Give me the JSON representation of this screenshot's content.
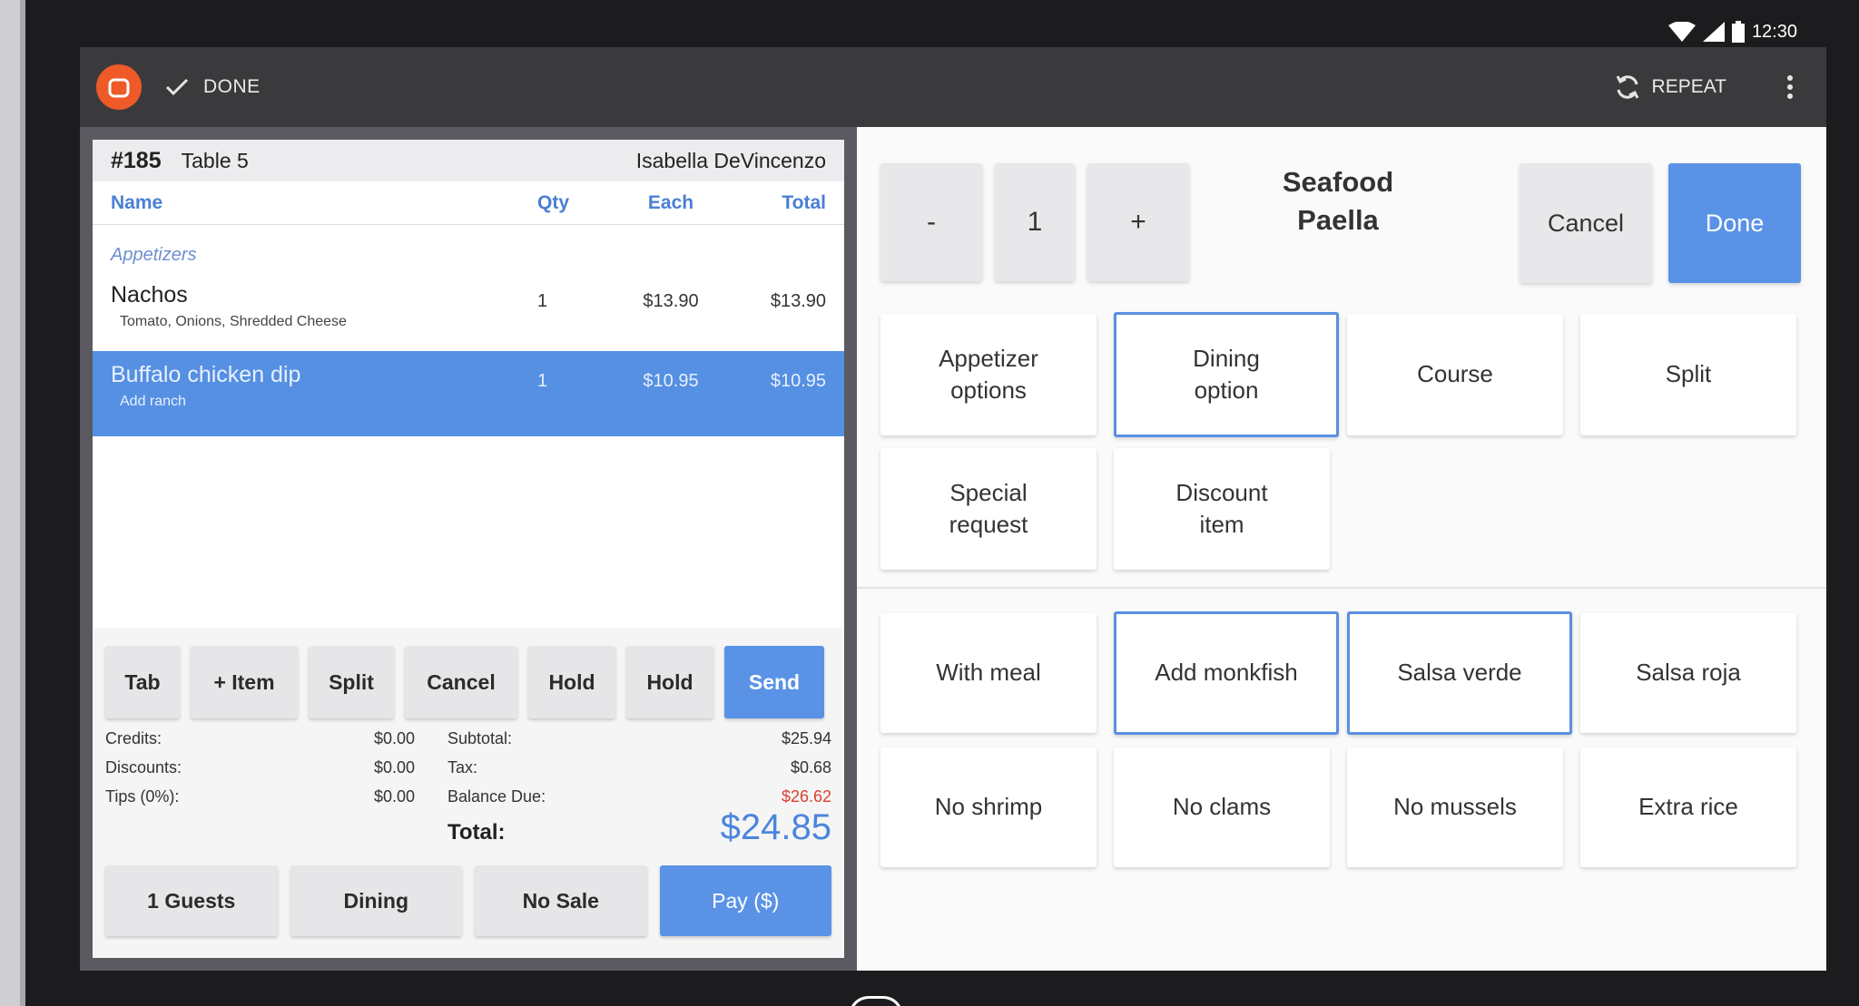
{
  "status": {
    "time": "12:30"
  },
  "appbar": {
    "done_label": "DONE",
    "repeat_label": "REPEAT"
  },
  "ticket": {
    "number": "#185",
    "table": "Table 5",
    "server": "Isabella DeVincenzo",
    "columns": {
      "name": "Name",
      "qty": "Qty",
      "each": "Each",
      "total": "Total"
    },
    "category": "Appetizers",
    "items": [
      {
        "name": "Nachos",
        "modifiers": "Tomato, Onions, Shredded Cheese",
        "qty": "1",
        "each": "$13.90",
        "total": "$13.90"
      },
      {
        "name": "Buffalo chicken dip",
        "modifiers": "Add ranch",
        "qty": "1",
        "each": "$10.95",
        "total": "$10.95"
      }
    ]
  },
  "actions": [
    "Tab",
    "+ Item",
    "Split",
    "Cancel",
    "Hold",
    "Hold",
    "Send"
  ],
  "totals": {
    "credits_label": "Credits:",
    "credits": "$0.00",
    "discounts_label": "Discounts:",
    "discounts": "$0.00",
    "tips_label": "Tips (0%):",
    "tips": "$0.00",
    "subtotal_label": "Subtotal:",
    "subtotal": "$25.94",
    "tax_label": "Tax:",
    "tax": "$0.68",
    "balance_label": "Balance Due:",
    "balance": "$26.62",
    "total_label": "Total:",
    "total": "$24.85"
  },
  "bottom": {
    "guests": "1 Guests",
    "dining": "Dining",
    "no_sale": "No Sale",
    "pay": "Pay ($)"
  },
  "editor": {
    "minus": "-",
    "quantity": "1",
    "plus": "+",
    "item_line1": "Seafood",
    "item_line2": "Paella",
    "cancel": "Cancel",
    "done": "Done",
    "options": [
      {
        "line1": "Appetizer",
        "line2": "options"
      },
      {
        "line1": "Dining",
        "line2": "option"
      },
      {
        "line1": "Course",
        "line2": ""
      },
      {
        "line1": "Split",
        "line2": ""
      },
      {
        "line1": "Special",
        "line2": "request"
      },
      {
        "line1": "Discount",
        "line2": "item"
      }
    ],
    "modifiers": [
      "With meal",
      "Add monkfish",
      "Salsa verde",
      "Salsa roja",
      "No shrimp",
      "No clams",
      "No mussels",
      "Extra rice"
    ]
  },
  "colors": {
    "accent": "#5a92e6",
    "brand": "#ee5a28",
    "balance_due": "#d9422e"
  }
}
